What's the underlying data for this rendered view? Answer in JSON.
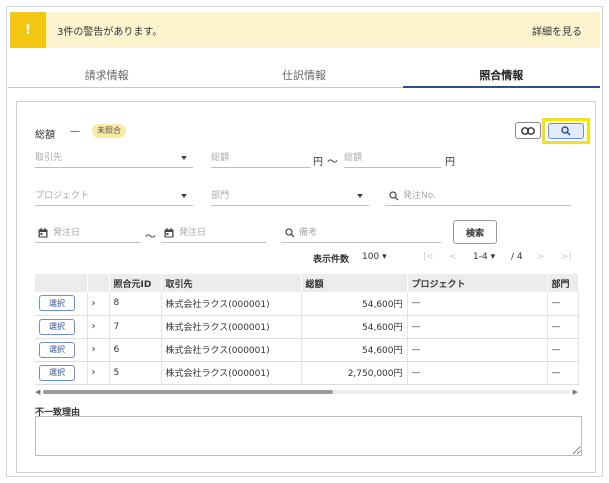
{
  "warning": {
    "badge": "!",
    "message": "3件の警告があります。",
    "link": "詳細を見る"
  },
  "tabs": [
    {
      "label": "請求情報",
      "active": false
    },
    {
      "label": "仕訳情報",
      "active": false
    },
    {
      "label": "照合情報",
      "active": true
    }
  ],
  "summary": {
    "label": "総額",
    "dash": "—",
    "status": "未照合"
  },
  "filters": {
    "vendor_placeholder": "取引先",
    "amount_placeholder_from": "総額",
    "amount_unit": "円",
    "range_sep": "〜",
    "amount_placeholder_to": "総額",
    "project_placeholder": "プロジェクト",
    "dept_placeholder": "部門",
    "order_no_placeholder": "発注No.",
    "order_date_from": "発注日",
    "order_date_to": "発注日",
    "memo_placeholder": "備考",
    "search_button": "検索"
  },
  "pager": {
    "label": "表示件数",
    "page_size": "100",
    "range": "1-4",
    "total": "/ 4",
    "first": "|<",
    "prev": "<",
    "next": ">",
    "last": ">|"
  },
  "table": {
    "headers": [
      "",
      "",
      "照合元ID",
      "取引先",
      "総額",
      "プロジェクト",
      "部門"
    ],
    "select_label": "選択",
    "rows": [
      {
        "id": "8",
        "vendor": "株式会社ラクス(000001)",
        "amount": "54,600円",
        "project": "—",
        "dept": "—"
      },
      {
        "id": "7",
        "vendor": "株式会社ラクス(000001)",
        "amount": "54,600円",
        "project": "—",
        "dept": "—"
      },
      {
        "id": "6",
        "vendor": "株式会社ラクス(000001)",
        "amount": "54,600円",
        "project": "—",
        "dept": "—"
      },
      {
        "id": "5",
        "vendor": "株式会社ラクス(000001)",
        "amount": "2,750,000円",
        "project": "—",
        "dept": "—"
      }
    ]
  },
  "reason": {
    "label": "不一致理由"
  },
  "colors": {
    "accent": "#2a4da0",
    "warning": "#f3c614",
    "highlight": "#f5e212"
  }
}
